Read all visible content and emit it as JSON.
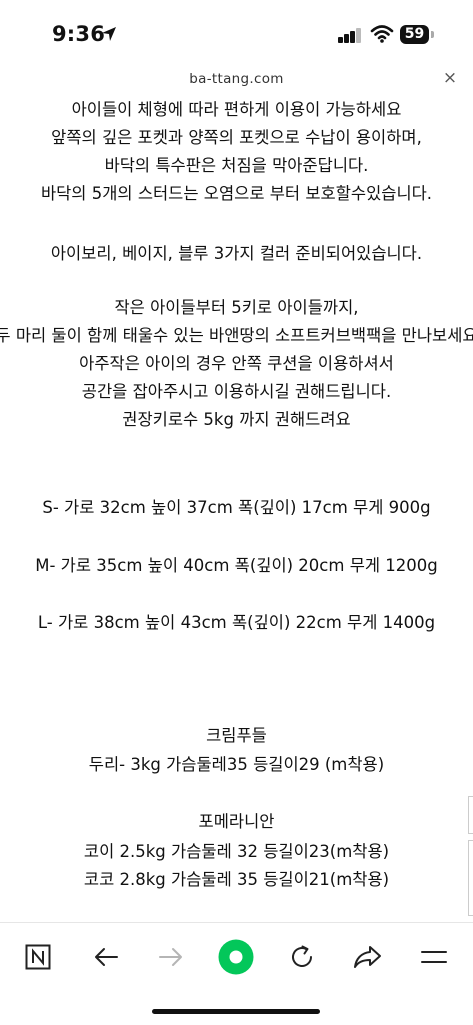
{
  "status": {
    "time": "9:36",
    "battery": "59"
  },
  "browser": {
    "url": "ba-ttang.com",
    "close_glyph": "×"
  },
  "content": {
    "lines": [
      "아이들이 체형에 따라 편하게 이용이 가능하세요",
      "앞쪽의 깊은 포켓과 양쪽의 포켓으로 수납이 용이하며,",
      "바닥의 특수판은 처짐을  막아준답니다.",
      "바닥의 5개의 스터드는 오염으로 부터 보호할수있습니다.",
      "아이보리, 베이지, 블루 3가지 컬러 준비되어있습니다.",
      "작은 아이들부터 5키로 아이들까지,",
      "두 마리 둘이 함께 태울수 있는 바앤땅의 소프트커브백팩을 만나보세요",
      "아주작은 아이의 경우 안쪽 쿠션을 이용하셔서",
      "공간을 잡아주시고 이용하시길 권해드립니다.",
      "권장키로수 5kg 까지 권해드려요",
      "S- 가로 32cm 높이 37cm 폭(깊이) 17cm 무게 900g",
      "M- 가로 35cm 높이 40cm 폭(깊이) 20cm 무게 1200g",
      "L- 가로 38cm 높이 43cm 폭(깊이) 22cm 무게 1400g",
      "크림푸들",
      "두리- 3kg 가슴둘레35 등길이29 (m착용)",
      "포메라니안",
      "코이 2.5kg 가슴둘레 32 등길이23(m착용)",
      "코코 2.8kg 가슴둘레 35 등길이21(m착용)"
    ]
  },
  "toolbar": {
    "items": [
      "naver-home",
      "back",
      "forward",
      "green-dot",
      "refresh",
      "share",
      "menu"
    ],
    "accent": "#03c75a"
  }
}
